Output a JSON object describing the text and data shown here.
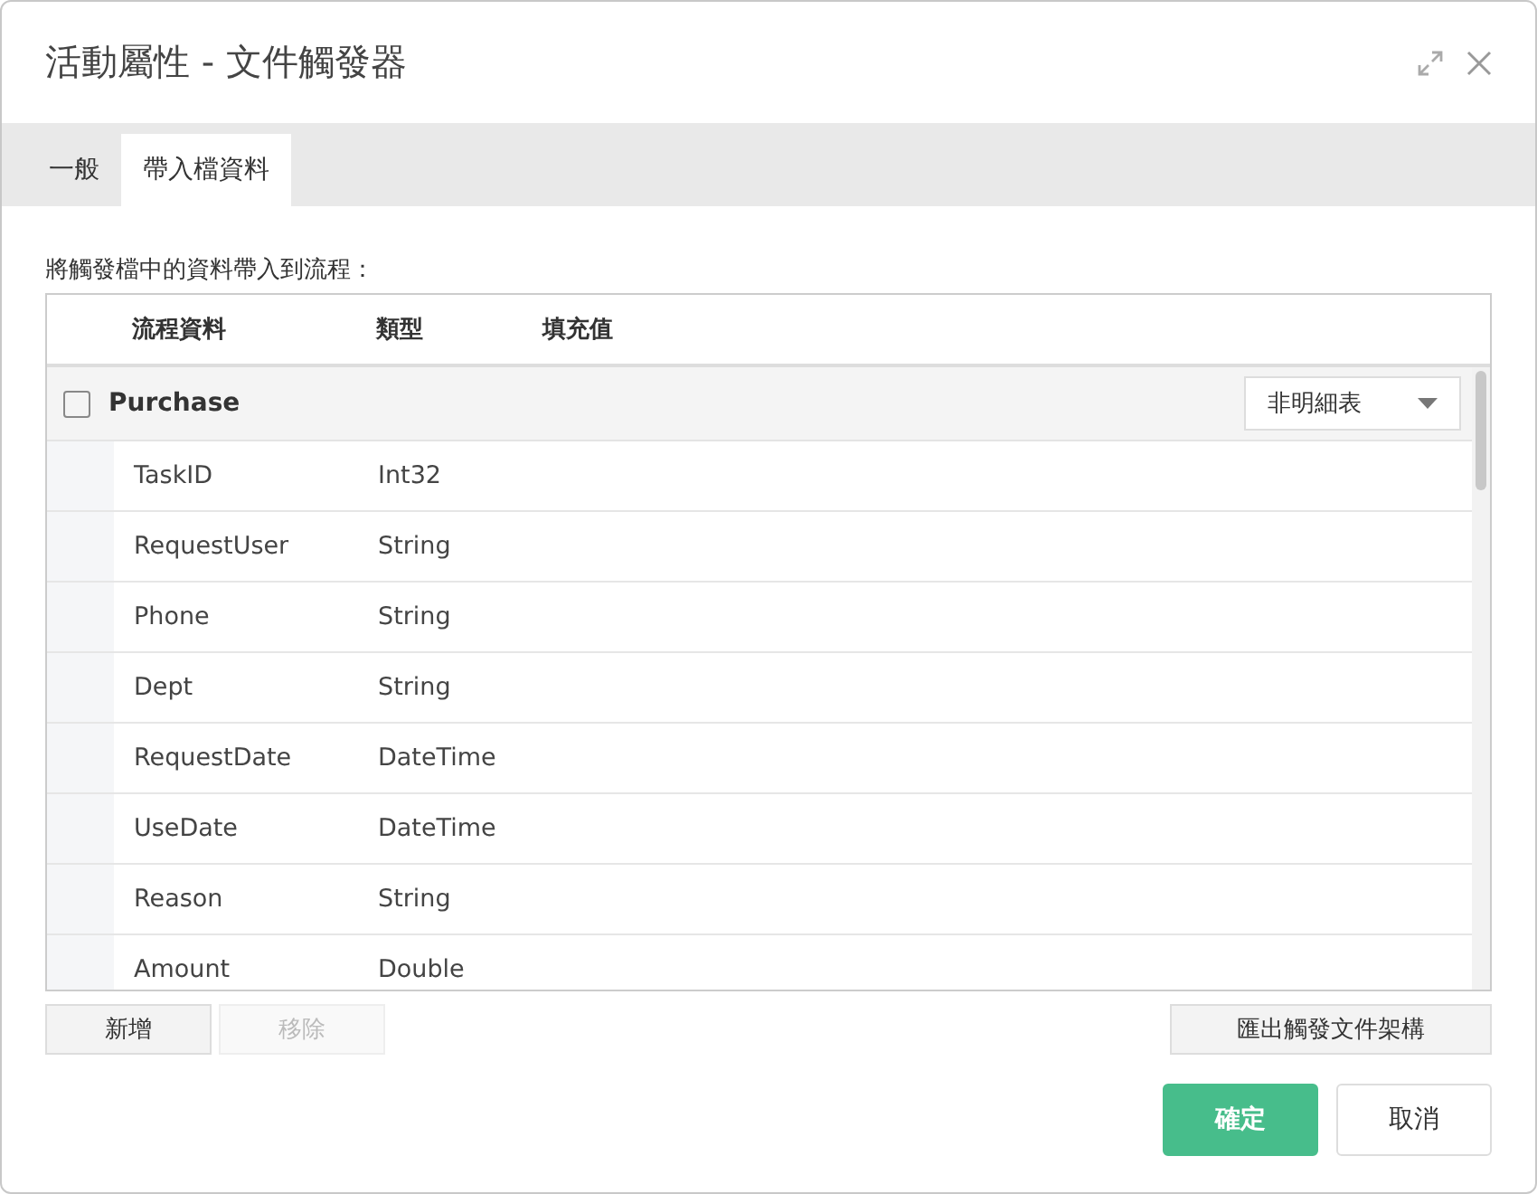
{
  "window": {
    "title": "活動屬性 - 文件觸發器"
  },
  "tabs": [
    {
      "label": "一般",
      "selected": false
    },
    {
      "label": "帶入檔資料",
      "selected": true
    }
  ],
  "description": "將觸發檔中的資料帶入到流程：",
  "table": {
    "columns": [
      "流程資料",
      "類型",
      "填充值"
    ],
    "group": {
      "name": "Purchase",
      "checked": false,
      "dropdown": "非明細表"
    },
    "rows": [
      {
        "name": "TaskID",
        "type": "Int32"
      },
      {
        "name": "RequestUser",
        "type": "String"
      },
      {
        "name": "Phone",
        "type": "String"
      },
      {
        "name": "Dept",
        "type": "String"
      },
      {
        "name": "RequestDate",
        "type": "DateTime"
      },
      {
        "name": "UseDate",
        "type": "DateTime"
      },
      {
        "name": "Reason",
        "type": "String"
      },
      {
        "name": "Amount",
        "type": "Double"
      }
    ]
  },
  "table_buttons": [
    {
      "label": "新增",
      "disabled": false
    },
    {
      "label": "移除",
      "disabled": true
    }
  ],
  "export_button": "匯出觸發文件架構",
  "footer_buttons": [
    {
      "label": "確定",
      "kind": "primary"
    },
    {
      "label": "取消",
      "kind": "secondary"
    }
  ]
}
